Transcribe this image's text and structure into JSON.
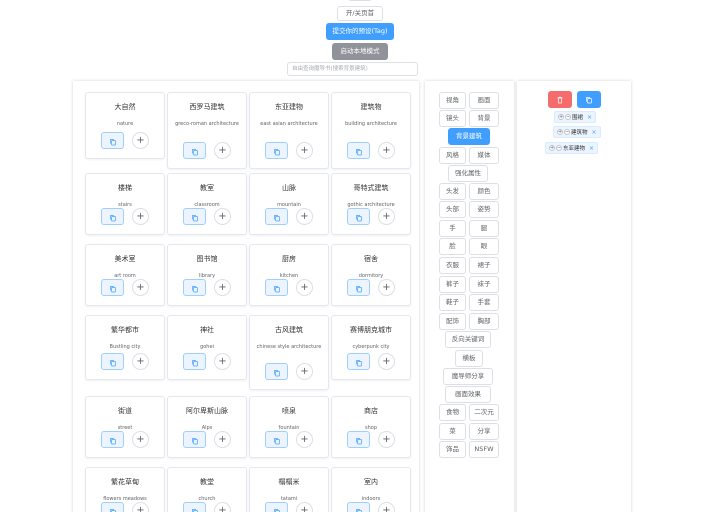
{
  "header": {
    "toggle_label": "开/关页首",
    "submit_label": "提交你的预设(Tag)",
    "local_label": "启动本地模式",
    "search_placeholder": "自由查询魔导书(搜索背景建筑)"
  },
  "cards": [
    {
      "zh": "大自然",
      "en": "nature"
    },
    {
      "zh": "西罗马建筑",
      "en": "greco-roman architecture"
    },
    {
      "zh": "东亚建物",
      "en": "east asian architecture"
    },
    {
      "zh": "建筑物",
      "en": "building architecture"
    },
    {
      "zh": "楼梯",
      "en": "stairs"
    },
    {
      "zh": "教室",
      "en": "classroom"
    },
    {
      "zh": "山脉",
      "en": "mountain"
    },
    {
      "zh": "哥特式建筑",
      "en": "gothic architecture"
    },
    {
      "zh": "美术室",
      "en": "art room"
    },
    {
      "zh": "图书馆",
      "en": "library"
    },
    {
      "zh": "厨房",
      "en": "kitchen"
    },
    {
      "zh": "宿舍",
      "en": "dormitory"
    },
    {
      "zh": "繁华都市",
      "en": "Bustling city"
    },
    {
      "zh": "神社",
      "en": "gohei"
    },
    {
      "zh": "古风建筑",
      "en": "chinese style architecture"
    },
    {
      "zh": "赛博朋克城市",
      "en": "cyberpunk city"
    },
    {
      "zh": "街道",
      "en": "street"
    },
    {
      "zh": "阿尔卑斯山脉",
      "en": "Alps"
    },
    {
      "zh": "喷泉",
      "en": "fountain"
    },
    {
      "zh": "商店",
      "en": "shop"
    },
    {
      "zh": "繁花草甸",
      "en": "flowers meadows"
    },
    {
      "zh": "教堂",
      "en": "church"
    },
    {
      "zh": "榻榻米",
      "en": "tatami"
    },
    {
      "zh": "室内",
      "en": "indoors"
    }
  ],
  "categories": [
    {
      "label": "视角"
    },
    {
      "label": "画面"
    },
    {
      "label": "镜头"
    },
    {
      "label": "背景"
    },
    {
      "label": "背景建筑",
      "active": true
    },
    {
      "label": "风格"
    },
    {
      "label": "媒体"
    },
    {
      "label": "强化属性"
    },
    {
      "label": "头发"
    },
    {
      "label": "颜色"
    },
    {
      "label": "头部"
    },
    {
      "label": "姿势"
    },
    {
      "label": "手"
    },
    {
      "label": "腿"
    },
    {
      "label": "脸"
    },
    {
      "label": "眼"
    },
    {
      "label": "衣服"
    },
    {
      "label": "裙子"
    },
    {
      "label": "裤子"
    },
    {
      "label": "袜子"
    },
    {
      "label": "鞋子"
    },
    {
      "label": "手套"
    },
    {
      "label": "配饰"
    },
    {
      "label": "胸部"
    },
    {
      "label": "反向关键词"
    },
    {
      "label": "横板"
    },
    {
      "label": "魔导师分享"
    },
    {
      "label": "画面效果"
    },
    {
      "label": "食物"
    },
    {
      "label": "二次元"
    },
    {
      "label": "菜"
    },
    {
      "label": "分享"
    },
    {
      "label": "饰品"
    },
    {
      "label": "NSFW"
    }
  ],
  "selected": [
    {
      "label": "围裙"
    },
    {
      "label": "建筑物"
    },
    {
      "label": "东亚建物"
    }
  ],
  "icons": {
    "copy": "copy-icon",
    "add": "plus-icon",
    "delete": "trash-icon",
    "remove_tag": "close-icon"
  },
  "colors": {
    "primary": "#409eff",
    "danger": "#f56c6c",
    "info": "#909399"
  }
}
